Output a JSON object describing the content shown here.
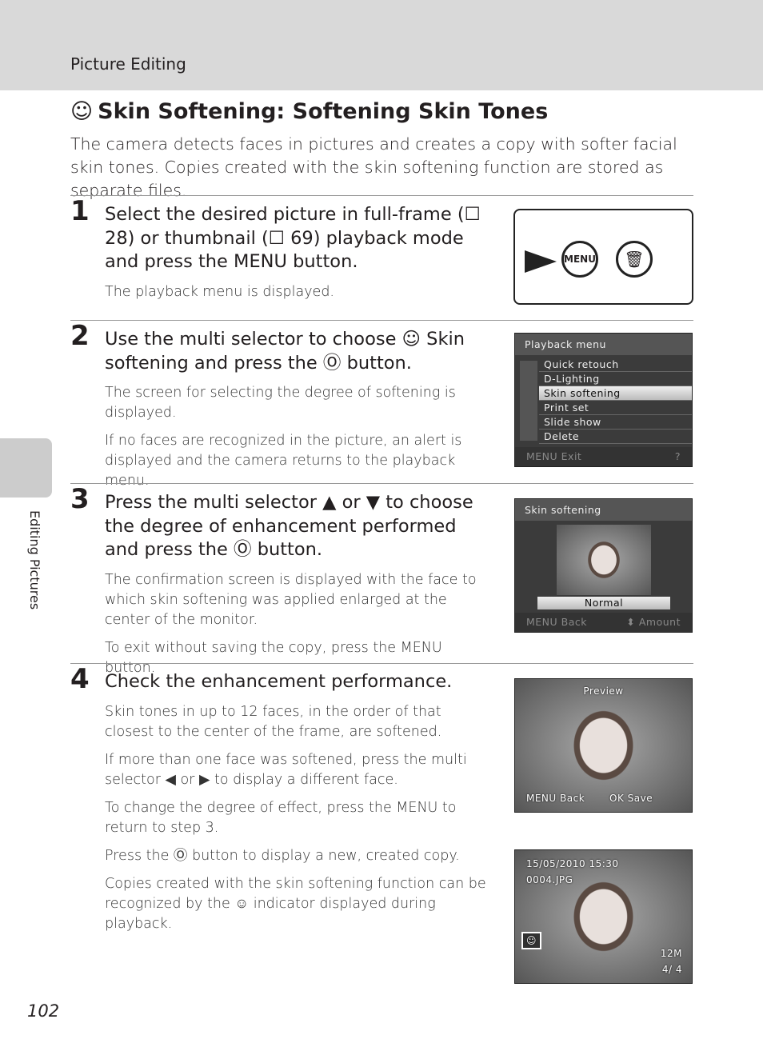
{
  "header": {
    "section": "Picture Editing"
  },
  "title": "Skin Softening: Softening Skin Tones",
  "intro": "The camera detects faces in pictures and creates a copy with softer facial skin tones. Copies created with the skin softening function are stored as separate files.",
  "side_tab": "Editing Pictures",
  "page_number": "102",
  "steps": [
    {
      "num": "1",
      "heading": "Select the desired picture in full-frame (☐ 28) or thumbnail (☐ 69) playback mode and press the MENU button.",
      "notes": [
        "The playback menu is displayed."
      ]
    },
    {
      "num": "2",
      "heading": "Use the multi selector to choose ☺ Skin softening and press the Ⓞ button.",
      "notes": [
        "The screen for selecting the degree of softening is displayed.",
        "If no faces are recognized in the picture, an alert is displayed and the camera returns to the playback menu."
      ]
    },
    {
      "num": "3",
      "heading": "Press the multi selector ▲ or ▼ to choose the degree of enhancement performed and press the Ⓞ button.",
      "notes": [
        "The confirmation screen is displayed with the face to which skin softening was applied enlarged at the center of the monitor.",
        "To exit without saving the copy, press the MENU button."
      ]
    },
    {
      "num": "4",
      "heading": "Check the enhancement performance.",
      "notes": [
        "Skin tones in up to 12 faces, in the order of that closest to the center of the frame, are softened.",
        "If more than one face was softened, press the multi selector ◀ or ▶ to display a different face.",
        "To change the degree of effect, press the MENU to return to step 3.",
        "Press the Ⓞ button to display a new, created copy.",
        "Copies created with the skin softening function can be recognized by the ☺ indicator displayed during playback."
      ]
    }
  ],
  "camera": {
    "menu_label": "MENU"
  },
  "playback_menu": {
    "title": "Playback menu",
    "items": [
      "Quick retouch",
      "D-Lighting",
      "Skin softening",
      "Print set",
      "Slide show",
      "Delete"
    ],
    "selected": "Skin softening",
    "footer_left": "MENU Exit",
    "footer_right": "?"
  },
  "skin_screen": {
    "title": "Skin softening",
    "value": "Normal",
    "footer_left": "MENU Back",
    "footer_right": "⬍ Amount"
  },
  "preview_screen": {
    "title": "Preview",
    "left": "MENU Back",
    "right": "OK Save"
  },
  "playback_screen": {
    "date": "15/05/2010 15:30",
    "file": "0004.JPG",
    "counter": "4/ 4",
    "image_mode": "12M"
  }
}
